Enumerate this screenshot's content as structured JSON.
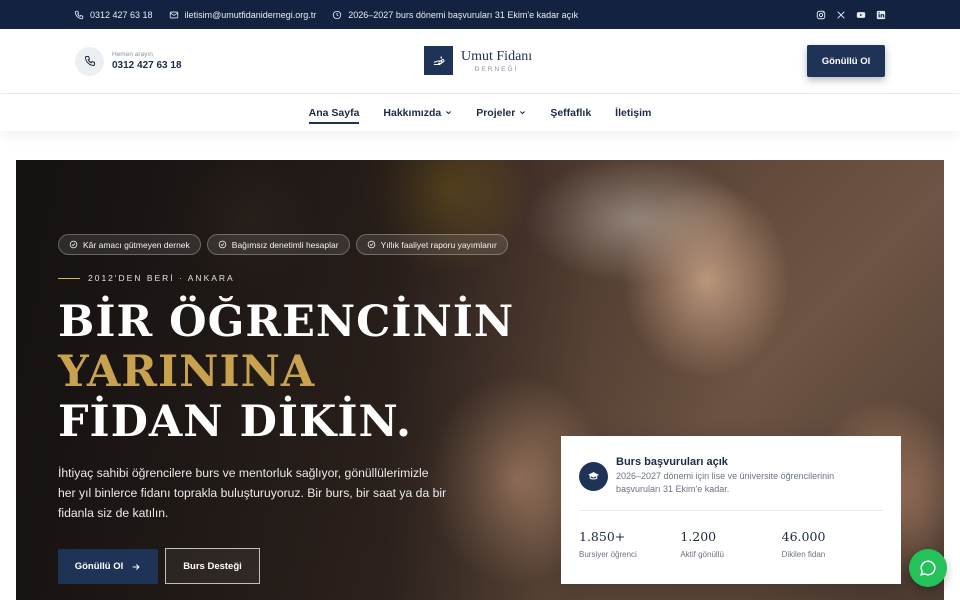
{
  "topbar": {
    "phone": "0312 427 63 18",
    "email": "iletisim@umutfidanidernegi.org.tr",
    "notice": "2026–2027 burs dönemi başvuruları 31 Ekim'e kadar açık",
    "socials": [
      "instagram-icon",
      "x-icon",
      "youtube-icon",
      "linkedin-icon"
    ]
  },
  "header": {
    "call_label": "Hemen arayın",
    "call_number": "0312 427 63 18",
    "logo_name": "Umut Fidanı",
    "logo_sub": "DERNEĞİ",
    "cta": "Gönüllü Ol"
  },
  "nav": {
    "items": [
      {
        "label": "Ana Sayfa",
        "active": true
      },
      {
        "label": "Hakkımızda",
        "dropdown": true
      },
      {
        "label": "Projeler",
        "dropdown": true
      },
      {
        "label": "Şeffaflık"
      },
      {
        "label": "İletişim"
      }
    ]
  },
  "hero": {
    "badges": [
      "Kâr amacı gütmeyen dernek",
      "Bağımsız denetimli hesaplar",
      "Yıllık faaliyet raporu yayımlanır"
    ],
    "eyebrow": "2012'DEN BERİ · ANKARA",
    "headline_1": "BİR ÖĞRENCİNİN",
    "headline_2": "YARININA",
    "headline_3": "FİDAN DİKİN.",
    "lead": "İhtiyaç sahibi öğrencilere burs ve mentorluk sağlıyor, gönüllülerimizle her yıl binlerce fidanı toprakla buluşturuyoruz. Bir burs, bir saat ya da bir fidanla siz de katılın.",
    "btn_primary": "Gönüllü Ol",
    "btn_secondary": "Burs Desteği"
  },
  "card": {
    "title": "Burs başvuruları açık",
    "desc": "2026–2027 dönemi için lise ve üniversite öğrencilerinin başvuruları 31 Ekim'e kadar.",
    "stats": [
      {
        "value": "1.850+",
        "label": "Bursiyer öğrenci"
      },
      {
        "value": "1.200",
        "label": "Aktif gönüllü"
      },
      {
        "value": "46.000",
        "label": "Dikilen fidan"
      }
    ]
  },
  "colors": {
    "navy": "#142242",
    "accent": "#1f3356",
    "gold": "#c9a24f",
    "whatsapp": "#25c25a"
  }
}
